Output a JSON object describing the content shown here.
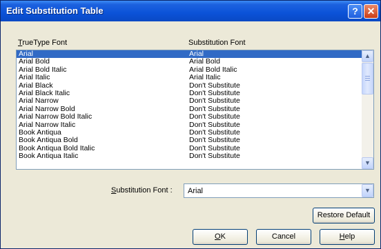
{
  "title": "Edit Substitution Table",
  "titlebar": {
    "help": "?",
    "close": "✕"
  },
  "columns": {
    "truetype": "TrueType Font",
    "substitution": "Substitution Font"
  },
  "rows": [
    {
      "font": "Arial",
      "sub": "Arial"
    },
    {
      "font": "Arial Bold",
      "sub": "Arial Bold"
    },
    {
      "font": "Arial Bold Italic",
      "sub": "Arial Bold Italic"
    },
    {
      "font": "Arial Italic",
      "sub": "Arial Italic"
    },
    {
      "font": "Arial Black",
      "sub": "Don't Substitute"
    },
    {
      "font": "Arial Black Italic",
      "sub": "Don't Substitute"
    },
    {
      "font": "Arial Narrow",
      "sub": "Don't Substitute"
    },
    {
      "font": "Arial Narrow Bold",
      "sub": "Don't Substitute"
    },
    {
      "font": "Arial Narrow Bold Italic",
      "sub": "Don't Substitute"
    },
    {
      "font": "Arial Narrow Italic",
      "sub": "Don't Substitute"
    },
    {
      "font": "Book Antiqua",
      "sub": "Don't Substitute"
    },
    {
      "font": "Book Antiqua Bold",
      "sub": "Don't Substitute"
    },
    {
      "font": "Book Antiqua Bold Italic",
      "sub": "Don't Substitute"
    },
    {
      "font": "Book Antiqua Italic",
      "sub": "Don't Substitute"
    }
  ],
  "selected_index": 0,
  "substitution_field": {
    "label": "Substitution Font :",
    "value": "Arial"
  },
  "buttons": {
    "restore": "Restore Default",
    "ok": "OK",
    "cancel": "Cancel",
    "help": "Help"
  },
  "colors": {
    "title_bar": "#0b52d8",
    "selection": "#316ac5"
  }
}
